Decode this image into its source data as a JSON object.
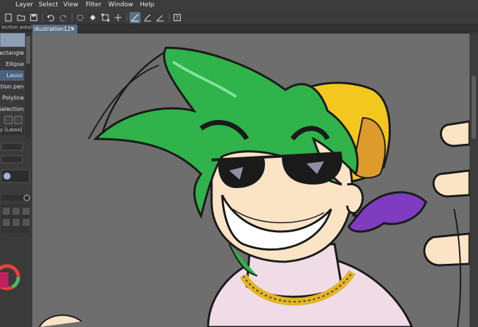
{
  "menu": {
    "items": [
      "Layer",
      "Select",
      "View",
      "Filter",
      "Window",
      "Help"
    ]
  },
  "toolbar": {
    "icons": [
      "new-file-icon",
      "open-file-icon",
      "save-icon",
      "undo-icon",
      "redo-icon",
      "loading-spinner-icon",
      "fill-icon",
      "transform-icon",
      "snap-icon",
      "ruler-icon",
      "pen-icon",
      "help-icon"
    ]
  },
  "left_panel": {
    "header": "lection area)",
    "items": [
      {
        "label": "Rectangle",
        "selected": false
      },
      {
        "label": "Ellipse",
        "selected": false
      },
      {
        "label": "Lasso",
        "selected": true
      },
      {
        "label": "ection pen",
        "selected": false
      },
      {
        "label": "Polyline",
        "selected": false
      },
      {
        "label": "Selection",
        "selected": false
      }
    ],
    "sub_header": "y [Lasso]"
  },
  "document_tab": {
    "title": "illustration12*",
    "close": "×"
  },
  "colors": {
    "accent": "#5a6e86",
    "canvas": "#6e6e6e",
    "hair": "#2fb34a",
    "hat": "#f2c71e",
    "skin": "#fbe3c6",
    "bandana": "#7f3cc0",
    "shirt": "#f0dce6"
  }
}
